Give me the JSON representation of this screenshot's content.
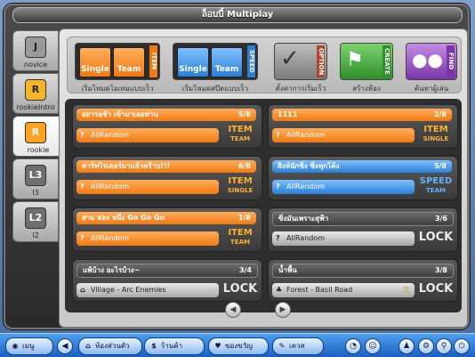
{
  "window": {
    "title": "ล็อบบี้ Multiplay"
  },
  "sidebar": {
    "tabs": [
      {
        "label": "novice",
        "icon_text": "J"
      },
      {
        "label": "rookieIntro",
        "icon_text": "R"
      },
      {
        "label": "rookie",
        "icon_text": "R"
      },
      {
        "label": "l3",
        "icon_text": "L3"
      },
      {
        "label": "l2",
        "icon_text": "L2"
      }
    ]
  },
  "modes": [
    {
      "caption": "เริ่มโหมดไอเทมแบบเร็ว",
      "tag": "ITEM",
      "btn1": "Single",
      "btn2": "Team"
    },
    {
      "caption": "เริ่มโหมดสปีดแบบเร็ว",
      "tag": "SPEED",
      "btn1": "Single",
      "btn2": "Team"
    },
    {
      "caption": "ตั้งค่าการเริ่มเร็ว",
      "tag": "OPTION"
    },
    {
      "caption": "สร้างห้อง",
      "tag": "CREATE"
    },
    {
      "caption": "ค้นหาผู้เล่น",
      "tag": "FIND"
    }
  ],
  "rooms": [
    {
      "name": "อย่ารอช้า เข้ามาเลยท่าน",
      "count": "5/8",
      "map": "AllRandom",
      "tag": "ITEM",
      "sub": "TEAM",
      "style": "orange"
    },
    {
      "name": "1111",
      "count": "2/8",
      "map": "AllRandom",
      "tag": "ITEM",
      "sub": "SINGLE",
      "style": "orange"
    },
    {
      "name": "คาร์ทไรเดอร์มาแล้วคร้าบ!!!",
      "count": "6/8",
      "map": "AllRandom",
      "tag": "ITEM",
      "sub": "SINGLE",
      "style": "orange"
    },
    {
      "name": "สิงห์นักซิ่ง ซิ่งทุกโค้ง",
      "count": "5/8",
      "map": "AllRandom",
      "tag": "SPEED",
      "sub": "TEAM",
      "style": "blue"
    },
    {
      "name": "สาม สอง หนึ่ง Go Go Go",
      "count": "1/8",
      "map": "AllRandom",
      "tag": "ITEM",
      "sub": "TEAM",
      "style": "orange"
    },
    {
      "name": "ซิ่งมันเพราะสุฟ้า",
      "count": "3/6",
      "map": "AllRandom",
      "tag": "LOCK",
      "sub": "",
      "style": "grey"
    },
    {
      "name": "แพ้บ้าง อะไรบ้าง~",
      "count": "3/4",
      "map": "Village - Arc Enemies",
      "tag": "LOCK",
      "sub": "",
      "style": "grey"
    },
    {
      "name": "น้ำพื้น",
      "count": "3/8",
      "map": "Forest - Basil Road",
      "tag": "LOCK",
      "sub": "",
      "style": "grey"
    }
  ],
  "taskbar": {
    "menu": "เมนู",
    "items": [
      "ห้องส่วนตัว",
      "ร้านค้า",
      "ของขวัญ",
      "เควส"
    ]
  }
}
